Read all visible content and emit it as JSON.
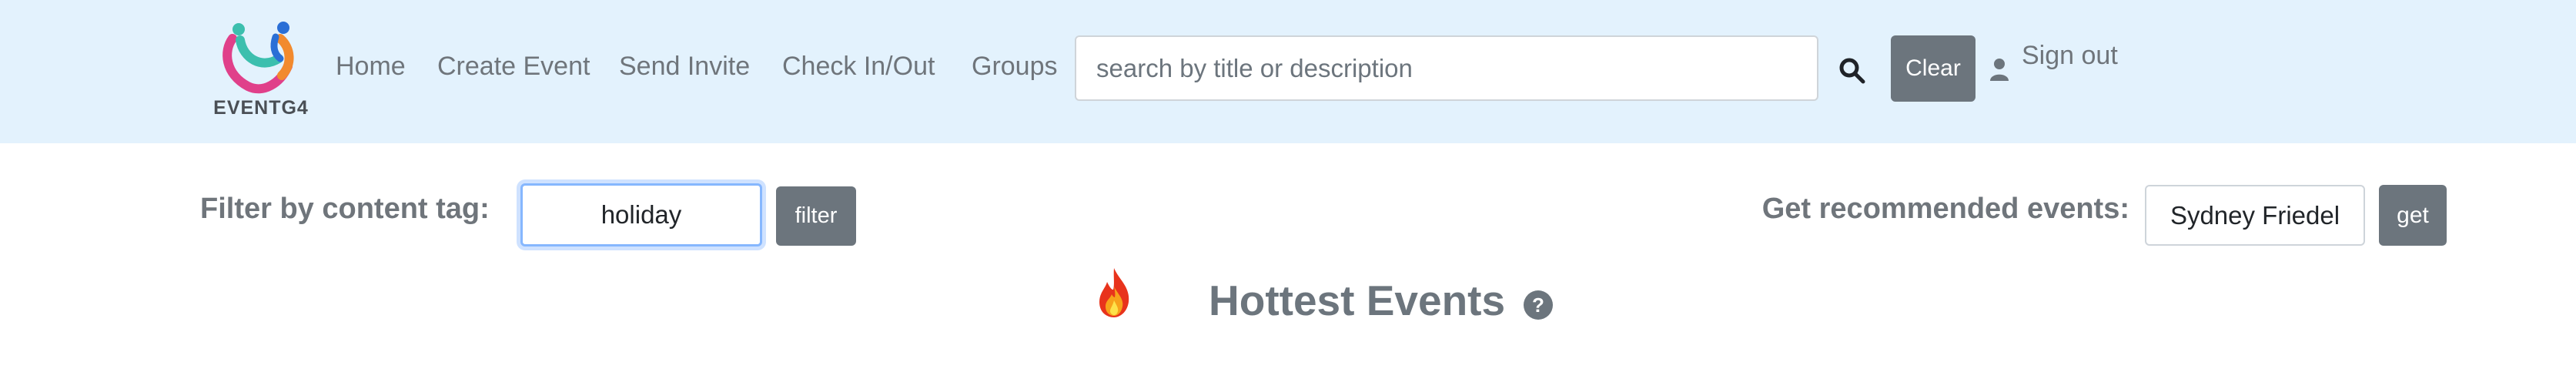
{
  "header": {
    "brand_name": "EVENTG4",
    "nav": [
      {
        "label": "Home"
      },
      {
        "label": "Create Event"
      },
      {
        "label": "Send Invite"
      },
      {
        "label": "Check In/Out"
      },
      {
        "label": "Groups"
      }
    ],
    "search": {
      "placeholder": "search by title or description",
      "value": "",
      "icon": "search-icon"
    },
    "clear_label": "Clear",
    "sign_out_label": "Sign out",
    "user_icon": "user-icon"
  },
  "filter": {
    "label": "Filter by content tag:",
    "value": "holiday",
    "button_label": "filter"
  },
  "recommend": {
    "label": "Get recommended events:",
    "value": "Sydney Friedel",
    "button_label": "get"
  },
  "section": {
    "title": "Hottest Events",
    "icon": "fire-icon",
    "help_icon": "question-circle-icon"
  },
  "colors": {
    "navbar_bg": "#e3f2fd",
    "button_bg": "#6c757d",
    "text_muted": "#6c757d",
    "focus_border": "#86b7fe"
  }
}
